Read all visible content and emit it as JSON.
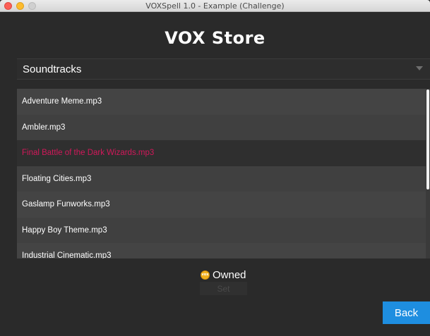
{
  "window": {
    "title": "VOXSpell 1.0 - Example (Challenge)"
  },
  "header": {
    "title": "VOX Store"
  },
  "category": {
    "selected": "Soundtracks"
  },
  "items": [
    {
      "label": "Adventure Meme.mp3",
      "selected": false
    },
    {
      "label": "Ambler.mp3",
      "selected": false
    },
    {
      "label": "Final Battle of the Dark Wizards.mp3",
      "selected": true
    },
    {
      "label": "Floating Cities.mp3",
      "selected": false
    },
    {
      "label": "Gaslamp Funworks.mp3",
      "selected": false
    },
    {
      "label": "Happy Boy Theme.mp3",
      "selected": false
    },
    {
      "label": "Industrial Cinematic.mp3",
      "selected": false
    }
  ],
  "status": {
    "coin_text": "vox",
    "owned_label": "Owned",
    "coin_icon": "coin-icon"
  },
  "buttons": {
    "set_label": "Set",
    "back_label": "Back"
  },
  "colors": {
    "accent": "#1e8ee0",
    "selected_text": "#d1185a",
    "coin": "#f2b01e"
  }
}
